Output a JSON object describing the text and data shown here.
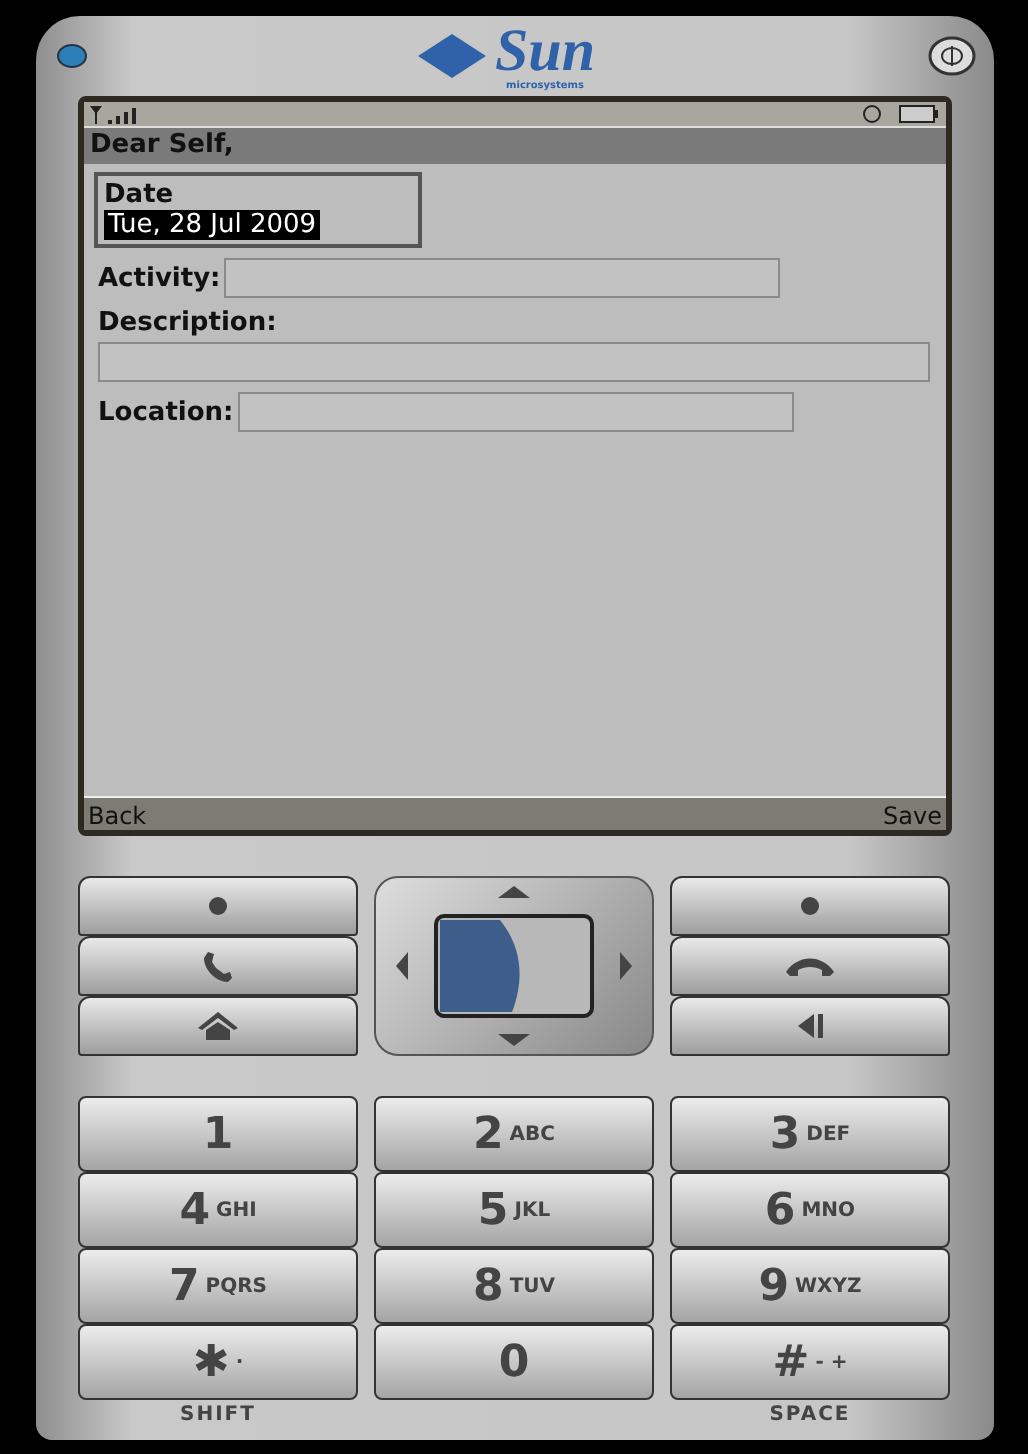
{
  "logo": {
    "name": "Sun",
    "tagline": "microsystems"
  },
  "screen": {
    "title": "Dear Self,",
    "form": [
      {
        "kind": "date",
        "label": "Date",
        "value": "Tue, 28 Jul 2009",
        "selected": true
      },
      {
        "kind": "inline",
        "label": "Activity:"
      },
      {
        "kind": "stacked",
        "label": "Description:"
      },
      {
        "kind": "inline",
        "label": "Location:"
      }
    ],
    "soft_keys": [
      "Back",
      "Save"
    ]
  },
  "nav_keys": {
    "left": [
      {
        "kind": "dot"
      },
      {
        "kind": "call"
      },
      {
        "kind": "home"
      }
    ],
    "right": [
      {
        "kind": "dot"
      },
      {
        "kind": "end"
      },
      {
        "kind": "back"
      }
    ]
  },
  "keypad": [
    {
      "digit": "1"
    },
    {
      "digit": "2",
      "letters": "ABC"
    },
    {
      "digit": "3",
      "letters": "DEF"
    },
    {
      "digit": "4",
      "letters": "GHI"
    },
    {
      "digit": "5",
      "letters": "JKL"
    },
    {
      "digit": "6",
      "letters": "MNO"
    },
    {
      "digit": "7",
      "letters": "PQRS"
    },
    {
      "digit": "8",
      "letters": "TUV"
    },
    {
      "digit": "9",
      "letters": "WXYZ"
    },
    {
      "digit": "✱",
      "letters": "·"
    },
    {
      "digit": "0"
    },
    {
      "digit": "#",
      "letters": "- +"
    }
  ],
  "key_captions": [
    "SHIFT",
    "SPACE"
  ]
}
